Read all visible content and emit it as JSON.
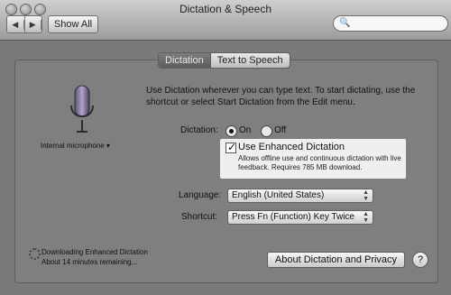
{
  "window": {
    "title": "Dictation & Speech"
  },
  "toolbar": {
    "back_icon": "left-arrow-icon",
    "forward_icon": "right-arrow-icon",
    "show_all": "Show All",
    "search": {
      "placeholder": ""
    }
  },
  "tabs": [
    {
      "label": "Dictation",
      "selected": true
    },
    {
      "label": "Text to Speech",
      "selected": false
    }
  ],
  "microphone": {
    "label": "Internal microphone ▾"
  },
  "intro_text": "Use Dictation wherever you can type text. To start dictating, use the shortcut or select Start Dictation from the Edit menu.",
  "dictation": {
    "label": "Dictation:",
    "on_label": "On",
    "off_label": "Off",
    "selected": "On"
  },
  "enhanced": {
    "checked": true,
    "label": "Use Enhanced Dictation",
    "note": "Allows offline use and continuous dictation with live feedback. Requires 785 MB download."
  },
  "language": {
    "label": "Language:",
    "value": "English (United States)"
  },
  "shortcut": {
    "label": "Shortcut:",
    "value": "Press Fn (Function) Key Twice"
  },
  "status": {
    "line1": "Downloading Enhanced Dictation",
    "line2": "About 14 minutes remaining..."
  },
  "buttons": {
    "about": "About Dictation and Privacy",
    "help": "?"
  }
}
